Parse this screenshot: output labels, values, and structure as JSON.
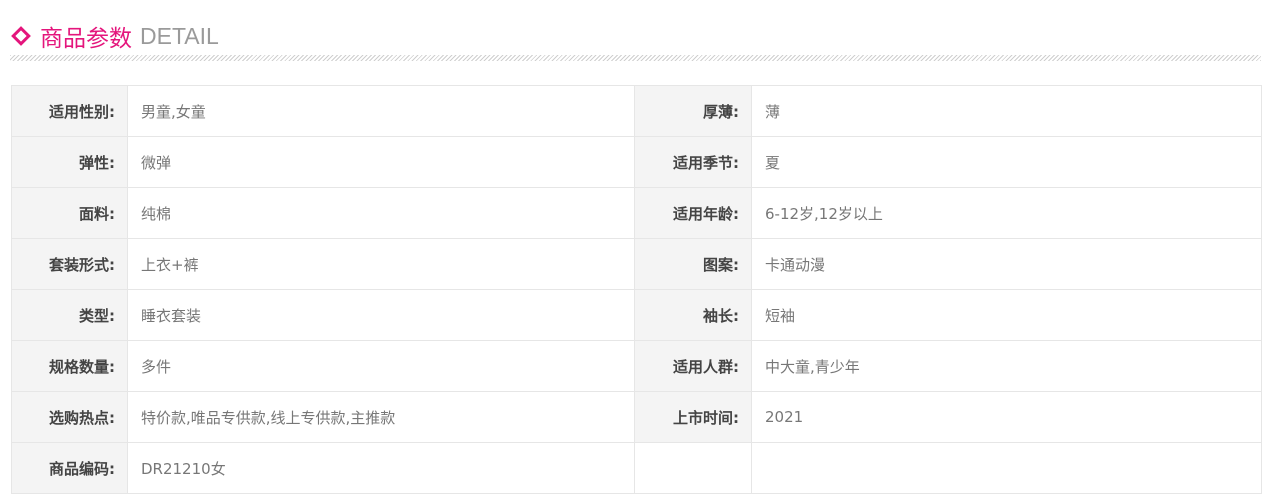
{
  "header": {
    "icon": "diamond-icon",
    "title_cn": "商品参数",
    "title_en": "DETAIL",
    "accent_color": "#e4157c"
  },
  "params": [
    {
      "left_label": "适用性别:",
      "left_value": "男童,女童",
      "right_label": "厚薄:",
      "right_value": "薄"
    },
    {
      "left_label": "弹性:",
      "left_value": "微弹",
      "right_label": "适用季节:",
      "right_value": "夏"
    },
    {
      "left_label": "面料:",
      "left_value": "纯棉",
      "right_label": "适用年龄:",
      "right_value": "6-12岁,12岁以上"
    },
    {
      "left_label": "套装形式:",
      "left_value": "上衣+裤",
      "right_label": "图案:",
      "right_value": "卡通动漫"
    },
    {
      "left_label": "类型:",
      "left_value": "睡衣套装",
      "right_label": "袖长:",
      "right_value": "短袖"
    },
    {
      "left_label": "规格数量:",
      "left_value": "多件",
      "right_label": "适用人群:",
      "right_value": "中大童,青少年"
    },
    {
      "left_label": "选购热点:",
      "left_value": "特价款,唯品专供款,线上专供款,主推款",
      "right_label": "上市时间:",
      "right_value": "2021"
    },
    {
      "left_label": "商品编码:",
      "left_value": "DR21210女",
      "right_label": "",
      "right_value": ""
    }
  ]
}
